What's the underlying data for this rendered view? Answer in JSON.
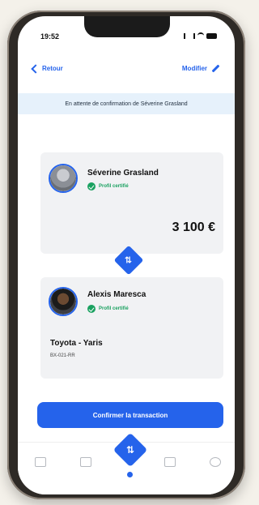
{
  "status_bar": {
    "time": "19:52"
  },
  "nav": {
    "back_label": "Retour",
    "edit_label": "Modifier"
  },
  "banner": {
    "text": "En attente de confirmation de Séverine Grasland"
  },
  "seller": {
    "name": "Séverine Grasland",
    "verified_label": "Profil certifié",
    "amount": "3 100 €"
  },
  "buyer": {
    "name": "Alexis Maresca",
    "verified_label": "Profil certifié"
  },
  "vehicle": {
    "name": "Toyota - Yaris",
    "plate": "BX-021-RR"
  },
  "confirm_button": {
    "label": "Confirmer la transaction"
  },
  "colors": {
    "accent": "#2563eb",
    "verified": "#1aa160",
    "banner_bg": "#e6f1fb"
  }
}
